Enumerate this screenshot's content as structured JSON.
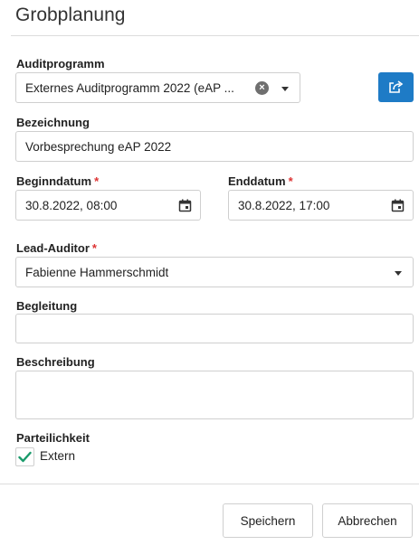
{
  "dialog": {
    "title": "Grobplanung"
  },
  "form": {
    "audit_program": {
      "label": "Auditprogramm",
      "value": "Externes Auditprogramm 2022 (eAP ...",
      "clear_icon": "clear-icon",
      "dropdown_icon": "chevron-down-icon"
    },
    "open_link_button": {
      "icon": "external-link-icon",
      "color": "#1e7bc6"
    },
    "designation": {
      "label": "Bezeichnung",
      "value": "Vorbesprechung eAP 2022"
    },
    "start_date": {
      "label": "Beginndatum",
      "required_marker": "*",
      "value": "30.8.2022, 08:00",
      "icon": "calendar-icon"
    },
    "end_date": {
      "label": "Enddatum",
      "required_marker": "*",
      "value": "30.8.2022, 17:00",
      "icon": "calendar-icon"
    },
    "lead_auditor": {
      "label": "Lead-Auditor",
      "required_marker": "*",
      "value": "Fabienne Hammerschmidt",
      "dropdown_icon": "caret-down-icon"
    },
    "escort": {
      "label": "Begleitung",
      "value": ""
    },
    "description": {
      "label": "Beschreibung",
      "value": ""
    },
    "partiality": {
      "label": "Parteilichkeit",
      "option_label": "Extern",
      "checked": true,
      "check_color": "#1a9b6b"
    }
  },
  "footer": {
    "save_label": "Speichern",
    "cancel_label": "Abbrechen"
  },
  "colors": {
    "required": "#dd3333",
    "border": "#cfcfcf"
  }
}
